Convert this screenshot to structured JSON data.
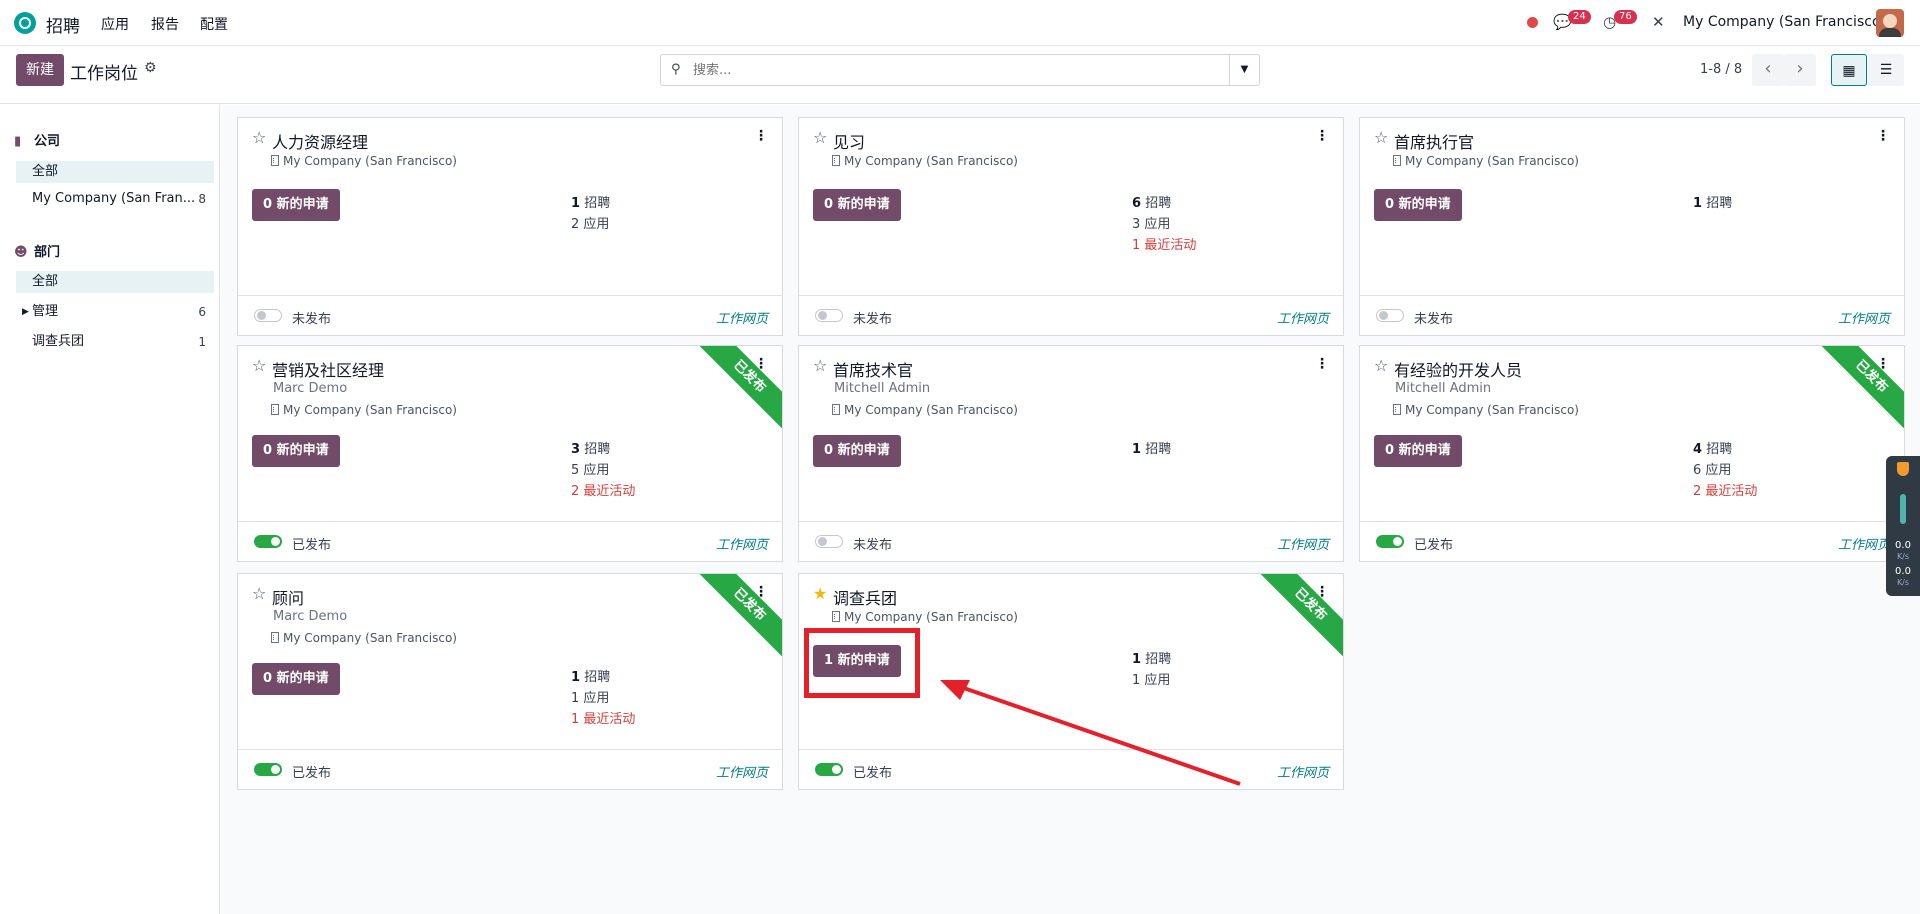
{
  "navbar": {
    "app_name": "招聘",
    "menus": [
      "应用",
      "报告",
      "配置"
    ],
    "messages_badge": "24",
    "activities_badge": "76",
    "company": "My Company (San Francisco)"
  },
  "control_panel": {
    "new_label": "新建",
    "title": "工作岗位",
    "search_placeholder": "搜索...",
    "pager": "1-8 / 8"
  },
  "sidebar": {
    "company_title": "公司",
    "company_items": [
      {
        "label": "全部",
        "count": ""
      },
      {
        "label": "My Company (San Fran...",
        "count": "8"
      }
    ],
    "dept_title": "部门",
    "dept_items": [
      {
        "label": "全部",
        "count": ""
      },
      {
        "label": "管理",
        "count": "6"
      },
      {
        "label": "调查兵团",
        "count": "1"
      }
    ]
  },
  "cards": [
    {
      "title": "人力资源经理",
      "user": "",
      "company": "My Company (San Francisco)",
      "applications": "0 新的申请",
      "recruit_num": "1",
      "recruit_label": "招聘",
      "apps_num": "2",
      "apps_label": "应用",
      "activity": "",
      "publish": "未发布",
      "published": false,
      "ribbon": "",
      "website": "工作网页",
      "starred": false
    },
    {
      "title": "见习",
      "user": "",
      "company": "My Company (San Francisco)",
      "applications": "0 新的申请",
      "recruit_num": "6",
      "recruit_label": "招聘",
      "apps_num": "3",
      "apps_label": "应用",
      "activity": "1 最近活动",
      "publish": "未发布",
      "published": false,
      "ribbon": "",
      "website": "工作网页",
      "starred": false
    },
    {
      "title": "首席执行官",
      "user": "",
      "company": "My Company (San Francisco)",
      "applications": "0 新的申请",
      "recruit_num": "1",
      "recruit_label": "招聘",
      "apps_num": "",
      "apps_label": "",
      "activity": "",
      "publish": "未发布",
      "published": false,
      "ribbon": "",
      "website": "工作网页",
      "starred": false
    },
    {
      "title": "营销及社区经理",
      "user": "Marc Demo",
      "company": "My Company (San Francisco)",
      "applications": "0 新的申请",
      "recruit_num": "3",
      "recruit_label": "招聘",
      "apps_num": "5",
      "apps_label": "应用",
      "activity": "2 最近活动",
      "publish": "已发布",
      "published": true,
      "ribbon": "已发布",
      "website": "工作网页",
      "starred": false
    },
    {
      "title": "首席技术官",
      "user": "Mitchell Admin",
      "company": "My Company (San Francisco)",
      "applications": "0 新的申请",
      "recruit_num": "1",
      "recruit_label": "招聘",
      "apps_num": "",
      "apps_label": "",
      "activity": "",
      "publish": "未发布",
      "published": false,
      "ribbon": "",
      "website": "工作网页",
      "starred": false
    },
    {
      "title": "有经验的开发人员",
      "user": "Mitchell Admin",
      "company": "My Company (San Francisco)",
      "applications": "0 新的申请",
      "recruit_num": "4",
      "recruit_label": "招聘",
      "apps_num": "6",
      "apps_label": "应用",
      "activity": "2 最近活动",
      "publish": "已发布",
      "published": true,
      "ribbon": "已发布",
      "website": "工作网页",
      "starred": false
    },
    {
      "title": "顾问",
      "user": "Marc Demo",
      "company": "My Company (San Francisco)",
      "applications": "0 新的申请",
      "recruit_num": "1",
      "recruit_label": "招聘",
      "apps_num": "1",
      "apps_label": "应用",
      "activity": "1 最近活动",
      "publish": "已发布",
      "published": true,
      "ribbon": "已发布",
      "website": "工作网页",
      "starred": false
    },
    {
      "title": "调查兵团",
      "user": "",
      "company": "My Company (San Francisco)",
      "applications": "1 新的申请",
      "recruit_num": "1",
      "recruit_label": "招聘",
      "apps_num": "1",
      "apps_label": "应用",
      "activity": "",
      "publish": "已发布",
      "published": true,
      "ribbon": "已发布",
      "website": "工作网页",
      "starred": true
    }
  ],
  "widget": {
    "up_value": "0.0",
    "up_unit": "K/s",
    "down_value": "0.0",
    "down_unit": "K/s"
  },
  "colors": {
    "brand": "#714b67",
    "published_green": "#28a745",
    "activity_red": "#d23f3a",
    "annotation_red": "#e3212b",
    "link_teal": "#017e84"
  },
  "icons": [
    "search-icon",
    "gear-icon",
    "chevron-left-icon",
    "chevron-right-icon",
    "kanban-view-icon",
    "list-view-icon",
    "star-icon",
    "kebab-menu-icon",
    "building-icon",
    "chat-icon",
    "clock-icon",
    "tools-icon"
  ]
}
